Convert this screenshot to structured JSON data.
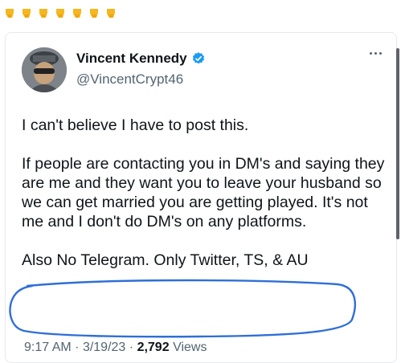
{
  "emoji_row": {
    "icon": "backhand-index-pointing-down-icon",
    "count": 7
  },
  "tweet": {
    "display_name": "Vincent Kennedy",
    "verified": true,
    "handle": "@VincentCrypt46",
    "paragraphs": [
      "I can't believe I have to post this.",
      "If people are contacting you in DM's and saying they are me and they want you to leave your husband so we can get married you are getting played. It's not me and I don't do DM's on any platforms.",
      "Also No Telegram. Only Twitter, TS, & AU"
    ],
    "time": "9:17 AM",
    "separator": "·",
    "date": "3/19/23",
    "views_count": "2,792",
    "views_label": "Views"
  },
  "colors": {
    "text": "#0f1419",
    "secondary": "#536471",
    "verified_badge": "#1d9bf0",
    "highlight_circle": "#2f6fd6",
    "emoji": "#f5b71f"
  }
}
